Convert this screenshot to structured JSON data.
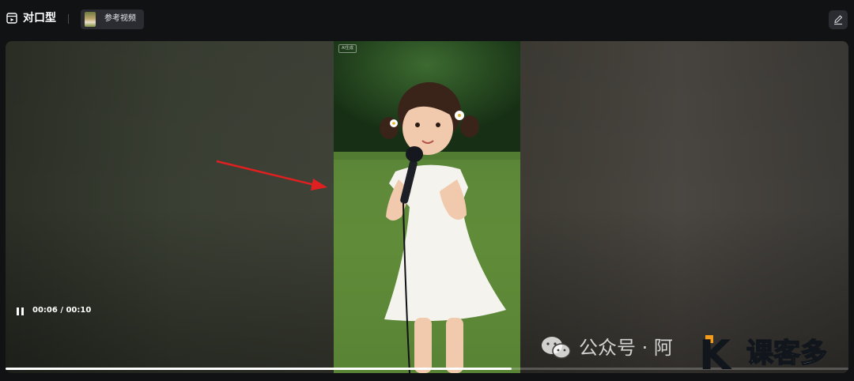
{
  "header": {
    "title": "对口型",
    "reference_chip_label": "参考视频"
  },
  "video": {
    "ai_badge": "AI生成",
    "time_display": "00:06 / 00:10",
    "progress_fraction": 0.6
  },
  "watermark": {
    "text": "公众号 · 阿",
    "logo_text": "课客多"
  },
  "colors": {
    "background": "#111214",
    "chip": "#2a2c31",
    "arrow": "#e02020"
  }
}
